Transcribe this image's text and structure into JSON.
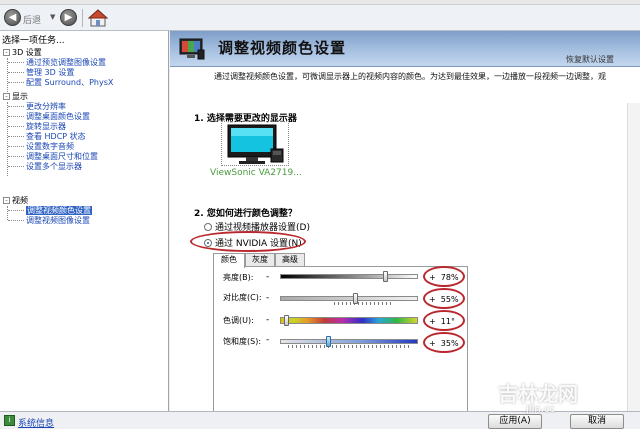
{
  "toolbar": {
    "back_label": "后退"
  },
  "left_pane": {
    "header": "选择一项任务...",
    "categories": [
      {
        "label": "3D 设置",
        "items": [
          "通过预览调整图像设置",
          "管理 3D 设置",
          "配置 Surround、PhysX"
        ]
      },
      {
        "label": "显示",
        "items": [
          "更改分辨率",
          "调整桌面颜色设置",
          "旋转显示器",
          "查看 HDCP 状态",
          "设置数字音频",
          "调整桌面尺寸和位置",
          "设置多个显示器"
        ]
      },
      {
        "label": "视频",
        "items": [
          "调整视频颜色设置",
          "调整视频图像设置"
        ]
      }
    ],
    "selected_item": "调整视频颜色设置"
  },
  "content": {
    "title": "调整视频颜色设置",
    "restore_defaults": "恢复默认设置",
    "intro": "通过调整视频颜色设置，可微调显示器上的视频内容的颜色。为达到最佳效果，一边播放一段视频一边调整，观",
    "section1_title": "1. 选择需要更改的显示器",
    "monitor_label": "ViewSonic VA2719...",
    "section2_title": "2. 您如何进行颜色调整？",
    "radio_options": [
      {
        "label": "通过视频播放器设置(D)",
        "checked": false
      },
      {
        "label": "通过 NVIDIA 设置(N)",
        "checked": true
      }
    ],
    "tabs": [
      {
        "label": "颜色",
        "active": true
      },
      {
        "label": "灰度",
        "active": false
      },
      {
        "label": "高级",
        "active": false
      }
    ],
    "sliders": [
      {
        "label": "亮度(B):",
        "value_text": "78%",
        "level": 0.78,
        "style": "gray"
      },
      {
        "label": "对比度(C):",
        "value_text": "55%",
        "level": 0.55,
        "style": "gray"
      },
      {
        "label": "色调(U):",
        "value_text": "11°",
        "level": 0.03,
        "style": "rainbow"
      },
      {
        "label": "饱和度(S):",
        "value_text": "35%",
        "level": 0.35,
        "style": "blue"
      }
    ]
  },
  "status_bar": {
    "sysinfo_label": "系统信息",
    "apply_label": "应用(A)",
    "cancel_label": "取消"
  },
  "watermark": {
    "text": "吉林龙网",
    "url": "jlin.cc"
  },
  "colors": {
    "banner": "#8fb0d8",
    "selected": "#3163c5",
    "link": "#1a46b4",
    "annotation": "#b8282e",
    "monitor_label": "#4a9a3e"
  }
}
